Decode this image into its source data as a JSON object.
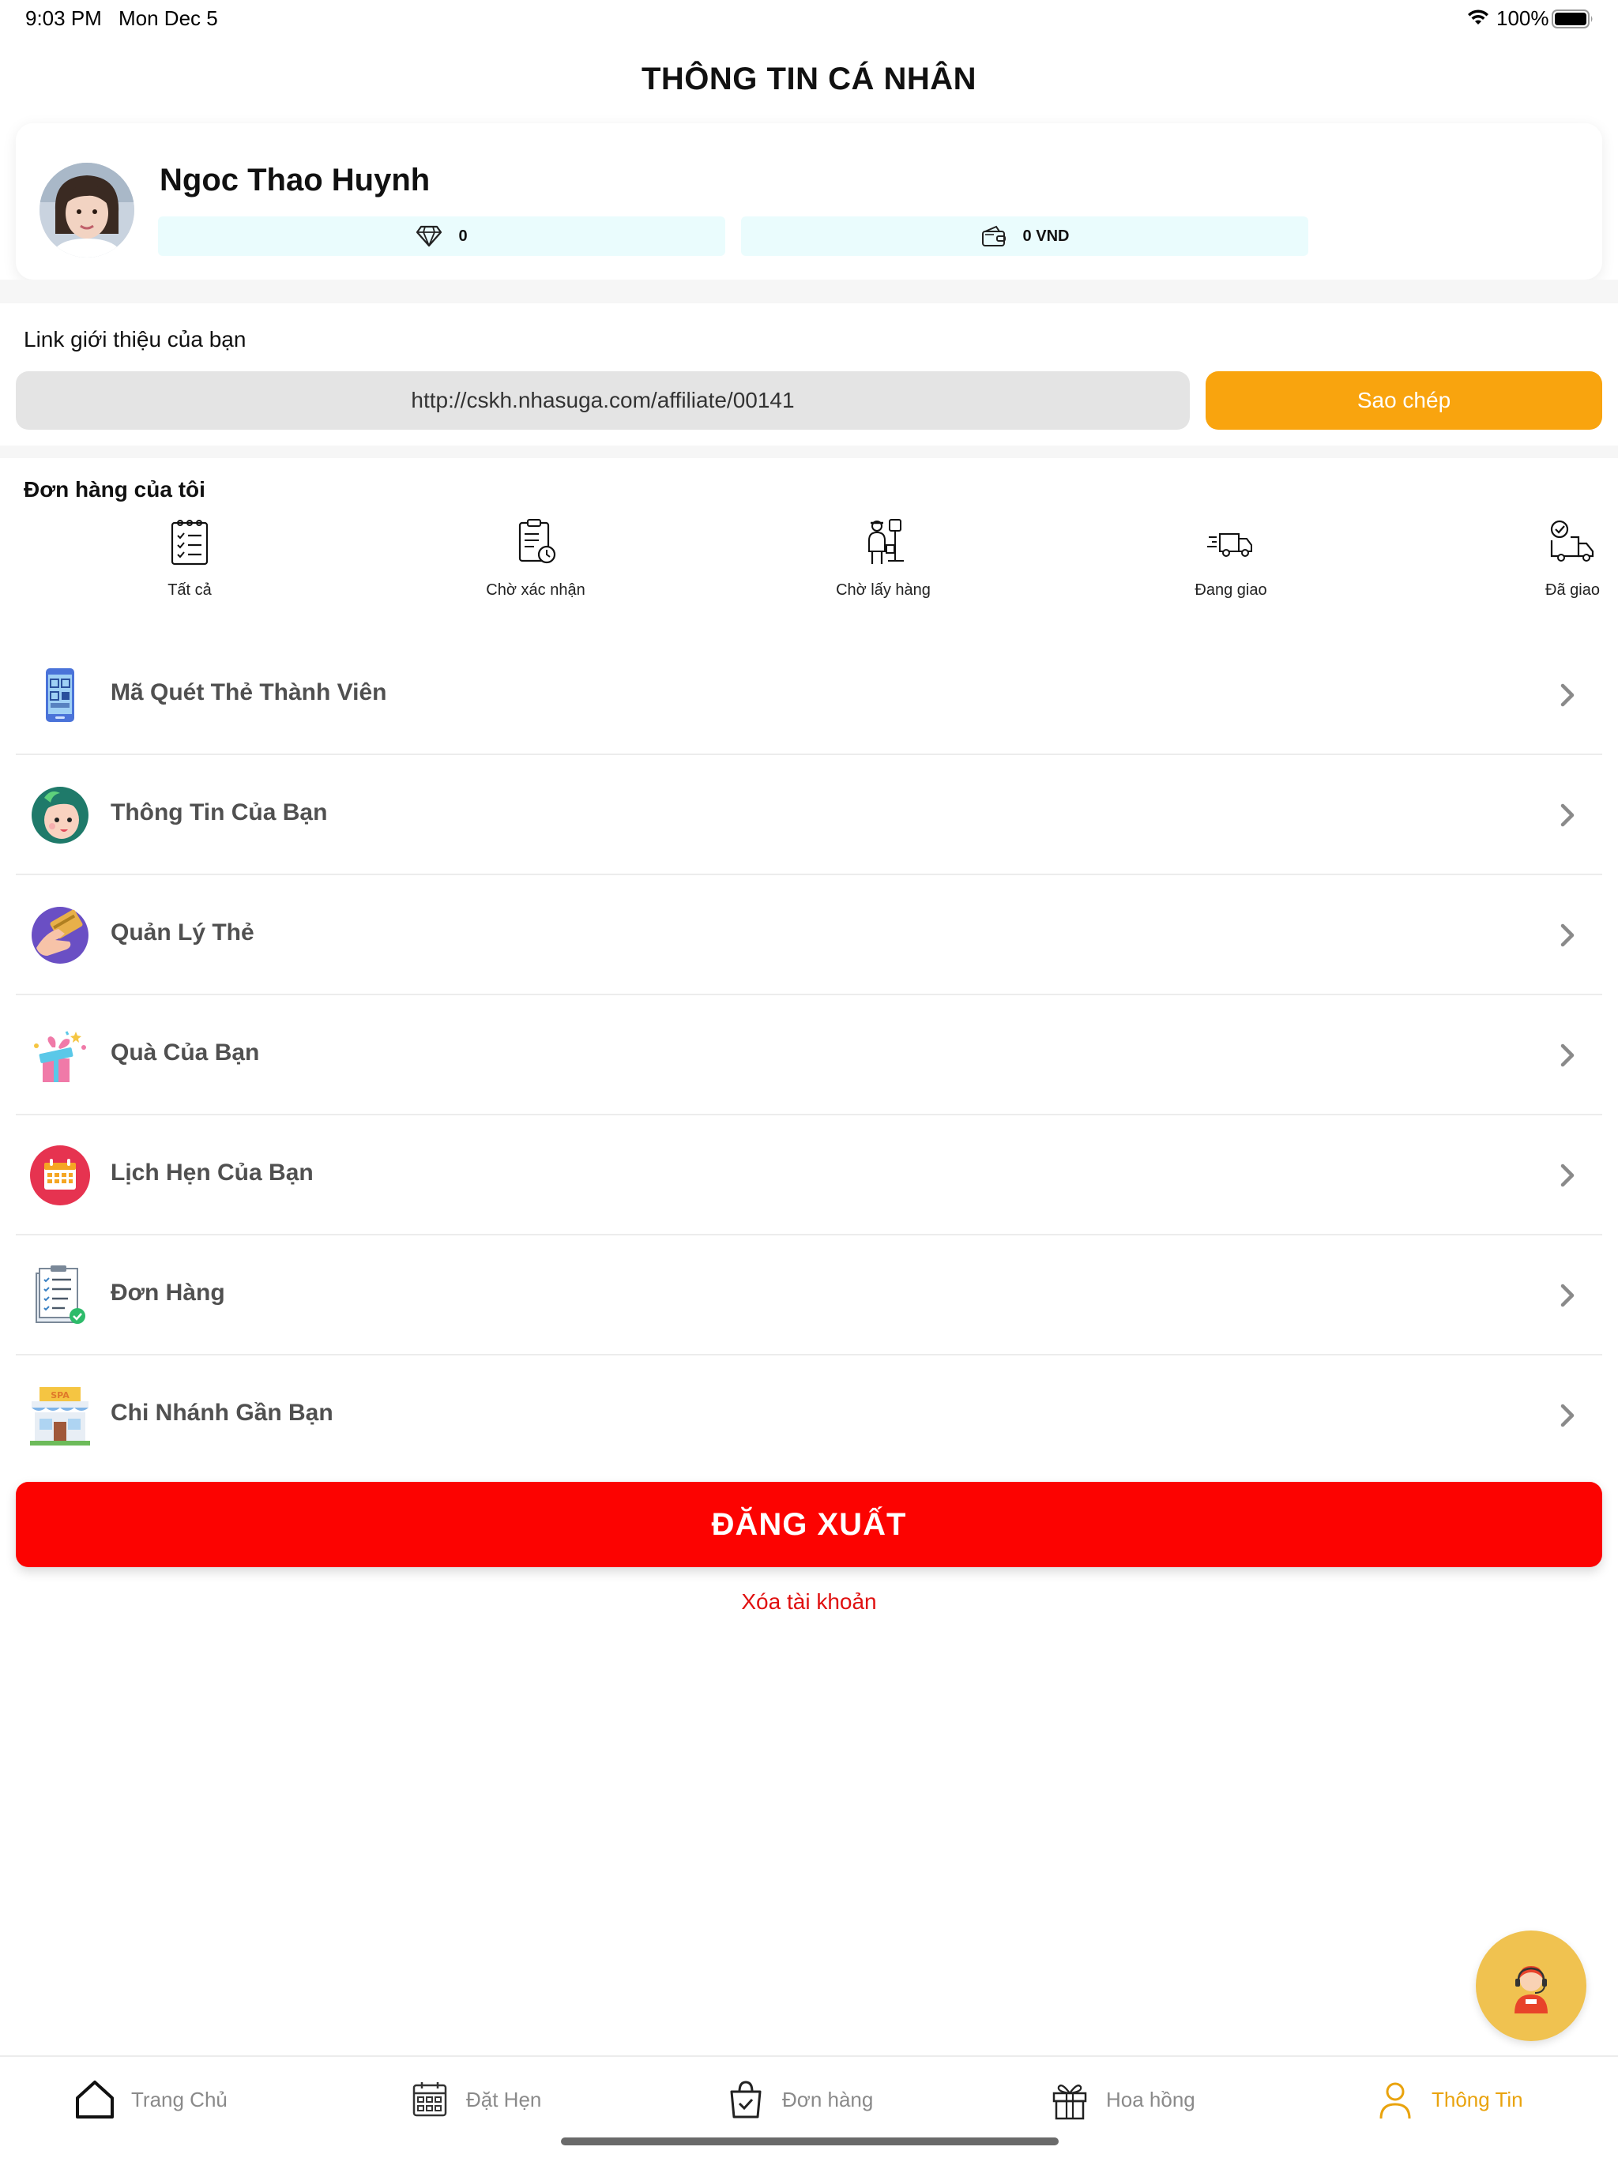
{
  "status_bar": {
    "time": "9:03 PM",
    "date": "Mon Dec 5",
    "battery": "100%"
  },
  "page_title": "THÔNG TIN CÁ NHÂN",
  "profile": {
    "name": "Ngoc Thao Huynh",
    "points": "0",
    "balance": "0 VND"
  },
  "referral": {
    "label": "Link giới thiệu của bạn",
    "url": "http://cskh.nhasuga.com/affiliate/00141",
    "copy_label": "Sao chép"
  },
  "orders": {
    "title": "Đơn hàng của tôi",
    "statuses": [
      {
        "label": "Tất cả",
        "icon": "clipboard-list-icon"
      },
      {
        "label": "Chờ xác nhận",
        "icon": "clipboard-clock-icon"
      },
      {
        "label": "Chờ lấy hàng",
        "icon": "courier-icon"
      },
      {
        "label": "Đang giao",
        "icon": "delivery-truck-icon"
      },
      {
        "label": "Đã giao",
        "icon": "delivered-icon"
      }
    ]
  },
  "menu": [
    {
      "label": "Mã Quét Thẻ Thành Viên",
      "icon": "qr-phone-icon"
    },
    {
      "label": "Thông Tin Của Bạn",
      "icon": "user-face-icon"
    },
    {
      "label": "Quản Lý Thẻ",
      "icon": "card-hand-icon"
    },
    {
      "label": "Quà Của Bạn",
      "icon": "gift-icon"
    },
    {
      "label": "Lịch Hẹn Của Bạn",
      "icon": "calendar-icon"
    },
    {
      "label": "Đơn Hàng",
      "icon": "order-list-icon"
    },
    {
      "label": "Chi Nhánh Gần Bạn",
      "icon": "spa-store-icon"
    }
  ],
  "logout_label": "ĐĂNG XUẤT",
  "delete_account_label": "Xóa tài khoản",
  "bottom_nav": [
    {
      "label": "Trang Chủ",
      "icon": "home-icon",
      "active": false
    },
    {
      "label": "Đặt Hẹn",
      "icon": "calendar-grid-icon",
      "active": false
    },
    {
      "label": "Đơn hàng",
      "icon": "shopping-bag-icon",
      "active": false
    },
    {
      "label": "Hoa hồng",
      "icon": "gift-box-icon",
      "active": false
    },
    {
      "label": "Thông Tin",
      "icon": "user-icon",
      "active": true
    }
  ],
  "colors": {
    "accent": "#f9a40e",
    "logout": "#fc0301",
    "active_nav": "#e9a30d",
    "stat_bg": "#eafcfd"
  }
}
